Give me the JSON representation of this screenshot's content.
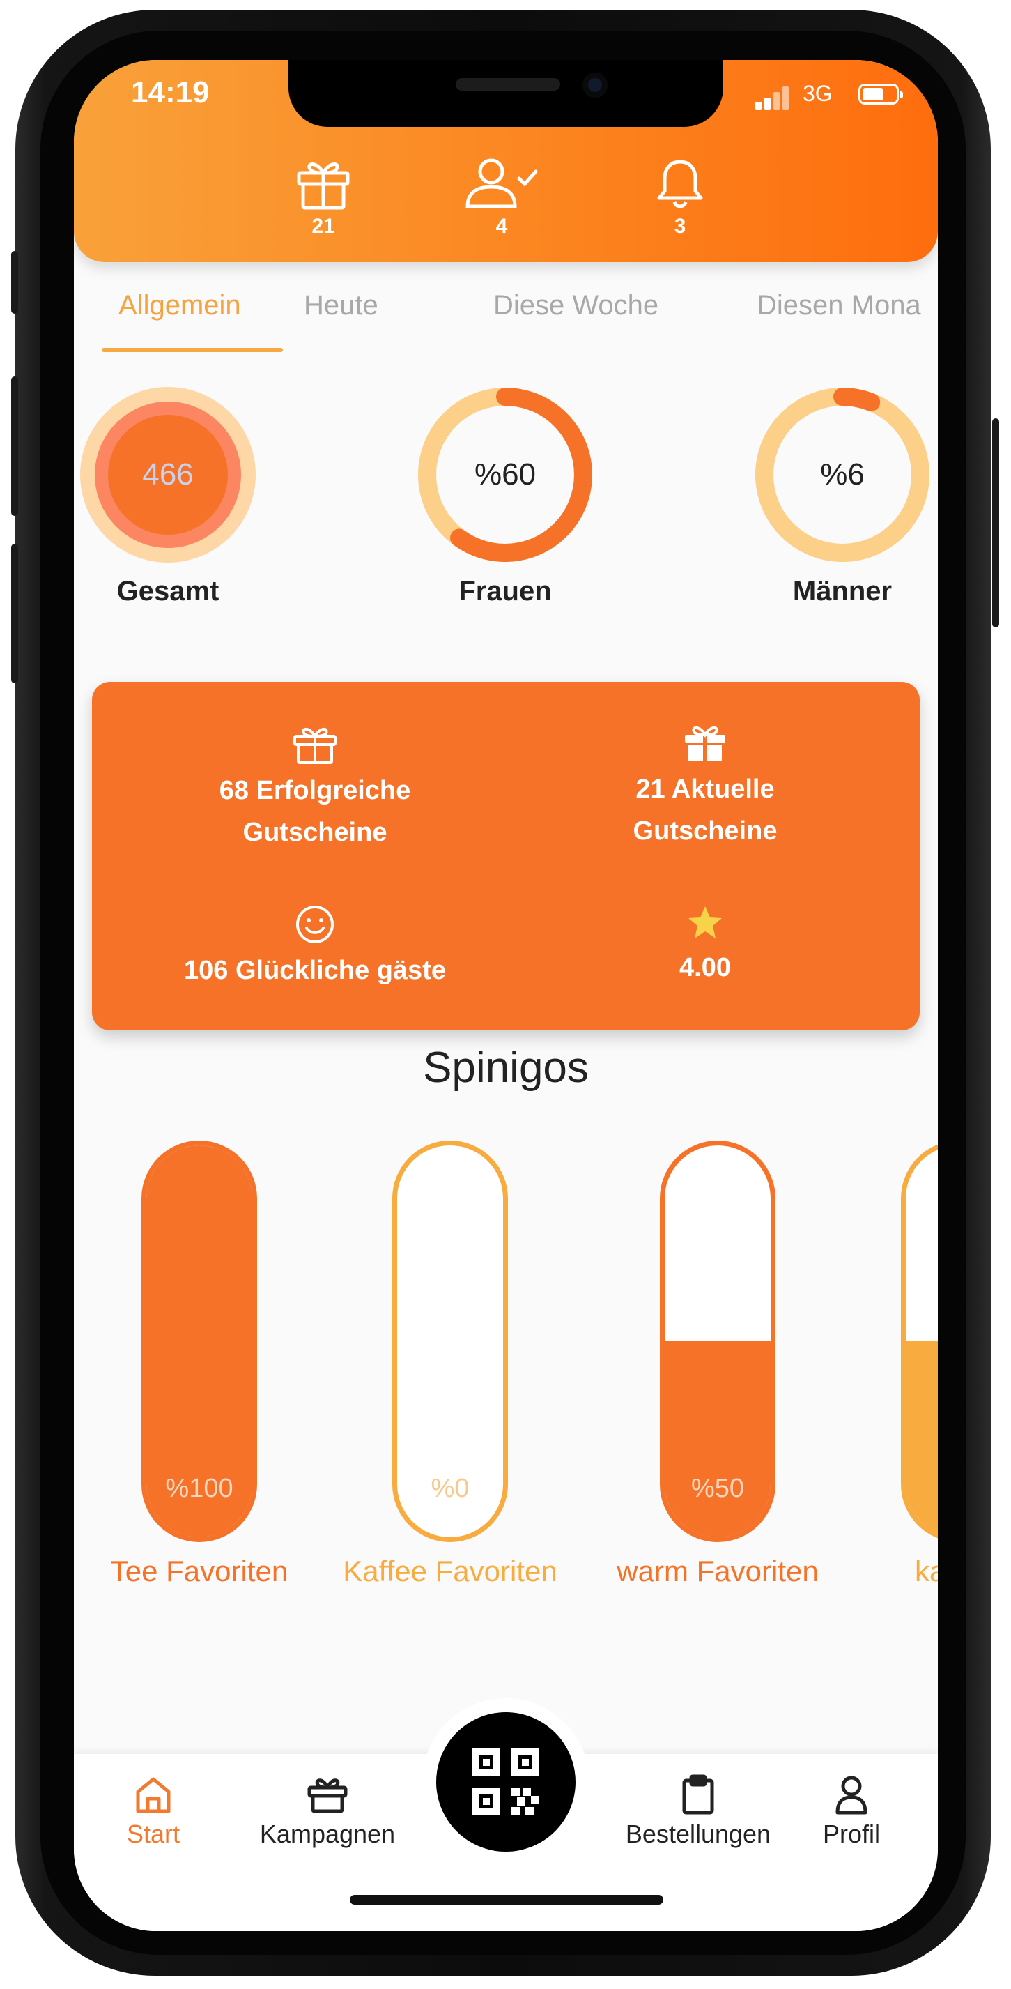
{
  "status_bar": {
    "time": "14:19",
    "network": "3G"
  },
  "header": {
    "gift_count": "21",
    "users_count": "4",
    "notifications_count": "3"
  },
  "tabs": [
    "Allgemein",
    "Heute",
    "Diese Woche",
    "Diesen Mona"
  ],
  "active_tab": "Allgemein",
  "stats": {
    "total": {
      "value": "466",
      "label": "Gesamt"
    },
    "women": {
      "value": "%60",
      "label": "Frauen",
      "fraction": 0.6
    },
    "men": {
      "value": "%6",
      "label": "Männer",
      "fraction": 0.06
    }
  },
  "summary": {
    "successful_vouchers": "68 Erfolgreiche Gutscheine",
    "current_vouchers": "21 Aktuelle Gutscheine",
    "happy_guests": "106 Glückliche gäste",
    "rating": "4.00"
  },
  "spinigos": {
    "title": "Spinigos",
    "items": [
      {
        "label": "Tee Favoriten",
        "percent_text": "%100",
        "fraction": 1.0,
        "color": "#f57228"
      },
      {
        "label": "Kaffee Favoriten",
        "percent_text": "%0",
        "fraction": 0.0,
        "color": "#f8ab3e"
      },
      {
        "label": "warm Favoriten",
        "percent_text": "%50",
        "fraction": 0.5,
        "color": "#f57228"
      },
      {
        "label": "kalt Fa",
        "percent_text": "%",
        "fraction": 0.5,
        "color": "#f8ab3e"
      }
    ]
  },
  "nav": {
    "start": "Start",
    "campaigns": "Kampagnen",
    "orders": "Bestellungen",
    "profile": "Profil"
  },
  "colors": {
    "accent_orange": "#f57228",
    "accent_light": "#f8ab3e",
    "ring_track": "#fdd08a"
  }
}
